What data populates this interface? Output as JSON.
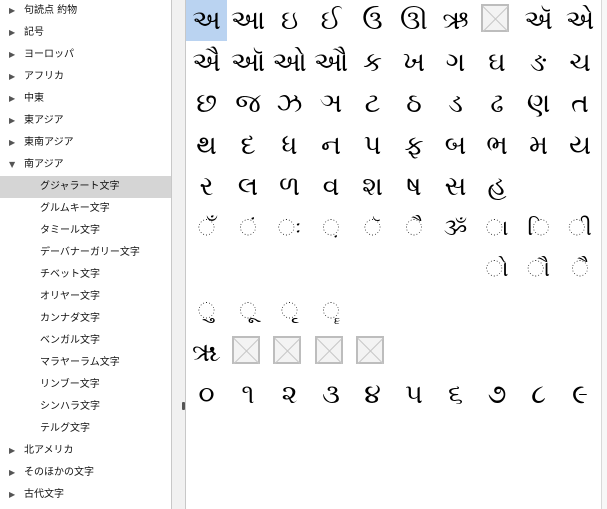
{
  "sidebar": {
    "items": [
      {
        "label": "句読点 約物",
        "type": "collapsed"
      },
      {
        "label": "記号",
        "type": "collapsed"
      },
      {
        "label": "ヨーロッパ",
        "type": "collapsed"
      },
      {
        "label": "アフリカ",
        "type": "collapsed"
      },
      {
        "label": "中東",
        "type": "collapsed"
      },
      {
        "label": "東アジア",
        "type": "collapsed"
      },
      {
        "label": "東南アジア",
        "type": "collapsed"
      },
      {
        "label": "南アジア",
        "type": "expanded"
      },
      {
        "label": "グジャラート文字",
        "type": "child",
        "selected": true
      },
      {
        "label": "グルムキー文字",
        "type": "child"
      },
      {
        "label": "タミール文字",
        "type": "child"
      },
      {
        "label": "デーバナーガリー文字",
        "type": "child"
      },
      {
        "label": "チベット文字",
        "type": "child"
      },
      {
        "label": "オリヤー文字",
        "type": "child"
      },
      {
        "label": "カンナダ文字",
        "type": "child"
      },
      {
        "label": "ベンガル文字",
        "type": "child"
      },
      {
        "label": "マラヤーラム文字",
        "type": "child"
      },
      {
        "label": "リンブー文字",
        "type": "child"
      },
      {
        "label": "シンハラ文字",
        "type": "child"
      },
      {
        "label": "テルグ文字",
        "type": "child"
      },
      {
        "label": "北アメリカ",
        "type": "collapsed"
      },
      {
        "label": "そのほかの文字",
        "type": "collapsed"
      },
      {
        "label": "古代文字",
        "type": "collapsed"
      }
    ]
  },
  "characters": [
    {
      "glyph": "અ",
      "selected": true
    },
    {
      "glyph": "આ"
    },
    {
      "glyph": "ઇ"
    },
    {
      "glyph": "ઈ"
    },
    {
      "glyph": "ઉ"
    },
    {
      "glyph": "ઊ"
    },
    {
      "glyph": "ઋ"
    },
    {
      "glyph": "",
      "missing": true
    },
    {
      "glyph": "ઍ"
    },
    {
      "glyph": "એ"
    },
    {
      "glyph": "ઐ"
    },
    {
      "glyph": "ઑ"
    },
    {
      "glyph": "ઓ"
    },
    {
      "glyph": "ઔ"
    },
    {
      "glyph": "ક"
    },
    {
      "glyph": "ખ"
    },
    {
      "glyph": "ગ"
    },
    {
      "glyph": "ઘ"
    },
    {
      "glyph": "ઙ"
    },
    {
      "glyph": "ચ"
    },
    {
      "glyph": "છ"
    },
    {
      "glyph": "જ"
    },
    {
      "glyph": "ઝ"
    },
    {
      "glyph": "ઞ"
    },
    {
      "glyph": "ટ"
    },
    {
      "glyph": "ઠ"
    },
    {
      "glyph": "ડ"
    },
    {
      "glyph": "ઢ"
    },
    {
      "glyph": "ણ"
    },
    {
      "glyph": "ત"
    },
    {
      "glyph": "થ"
    },
    {
      "glyph": "દ"
    },
    {
      "glyph": "ધ"
    },
    {
      "glyph": "ન"
    },
    {
      "glyph": "પ"
    },
    {
      "glyph": "ફ"
    },
    {
      "glyph": "બ"
    },
    {
      "glyph": "ભ"
    },
    {
      "glyph": "મ"
    },
    {
      "glyph": "ય"
    },
    {
      "glyph": "ર"
    },
    {
      "glyph": "લ"
    },
    {
      "glyph": "ળ"
    },
    {
      "glyph": "વ"
    },
    {
      "glyph": "શ"
    },
    {
      "glyph": "ષ"
    },
    {
      "glyph": "સ"
    },
    {
      "glyph": "હ"
    },
    {
      "glyph": ""
    },
    {
      "glyph": ""
    },
    {
      "glyph": "ઁ"
    },
    {
      "glyph": "ં"
    },
    {
      "glyph": "ઃ"
    },
    {
      "glyph": "઼"
    },
    {
      "glyph": "ૅ"
    },
    {
      "glyph": "ૈ"
    },
    {
      "glyph": "ૐ"
    },
    {
      "glyph": "ા"
    },
    {
      "glyph": "િ"
    },
    {
      "glyph": "ી"
    },
    {
      "glyph": ""
    },
    {
      "glyph": ""
    },
    {
      "glyph": ""
    },
    {
      "glyph": ""
    },
    {
      "glyph": ""
    },
    {
      "glyph": ""
    },
    {
      "glyph": ""
    },
    {
      "glyph": "ો"
    },
    {
      "glyph": "ૌ"
    },
    {
      "glyph": "ૈ"
    },
    {
      "glyph": "ુ"
    },
    {
      "glyph": "ૂ"
    },
    {
      "glyph": "ૃ"
    },
    {
      "glyph": "ૄ"
    },
    {
      "glyph": ""
    },
    {
      "glyph": ""
    },
    {
      "glyph": ""
    },
    {
      "glyph": ""
    },
    {
      "glyph": ""
    },
    {
      "glyph": ""
    },
    {
      "glyph": "ૠ"
    },
    {
      "glyph": "",
      "missing": true
    },
    {
      "glyph": "",
      "missing": true
    },
    {
      "glyph": "",
      "missing": true
    },
    {
      "glyph": "",
      "missing": true
    },
    {
      "glyph": ""
    },
    {
      "glyph": ""
    },
    {
      "glyph": ""
    },
    {
      "glyph": ""
    },
    {
      "glyph": ""
    },
    {
      "glyph": "૦"
    },
    {
      "glyph": "૧"
    },
    {
      "glyph": "૨"
    },
    {
      "glyph": "૩"
    },
    {
      "glyph": "૪"
    },
    {
      "glyph": "૫"
    },
    {
      "glyph": "૬"
    },
    {
      "glyph": "૭"
    },
    {
      "glyph": "૮"
    },
    {
      "glyph": "૯"
    }
  ]
}
